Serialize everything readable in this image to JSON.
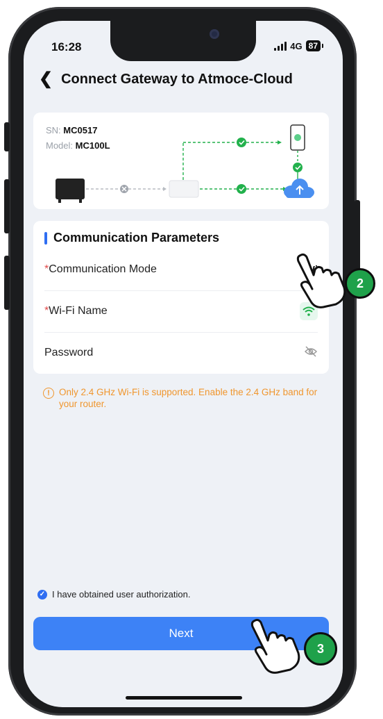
{
  "status_bar": {
    "time": "16:28",
    "network": "4G",
    "battery": "87"
  },
  "header": {
    "title": "Connect Gateway to Atmoce-Cloud"
  },
  "device": {
    "sn_label": "SN:",
    "sn_value": "MC0517",
    "model_label": "Model:",
    "model_value": "MC100L"
  },
  "params": {
    "section_title": "Communication Parameters",
    "rows": [
      {
        "required": "*",
        "label": "Communication Mode",
        "value": "Wi"
      },
      {
        "required": "*",
        "label": "Wi-Fi Name",
        "icon": "wifi-icon"
      },
      {
        "required": "",
        "label": "Password",
        "icon": "eye-off-icon"
      }
    ]
  },
  "notice": {
    "icon": "warning-icon",
    "text": "Only 2.4 GHz Wi-Fi is supported. Enable the 2.4 GHz band for your router."
  },
  "consent": {
    "text": "I have obtained user authorization."
  },
  "next_button": {
    "label": "Next"
  },
  "annotations": {
    "step_a": "2",
    "step_b": "3"
  },
  "colors": {
    "accent": "#3d82f6",
    "warning": "#f0962e",
    "success": "#1fa14a",
    "required": "#e24b4b"
  }
}
